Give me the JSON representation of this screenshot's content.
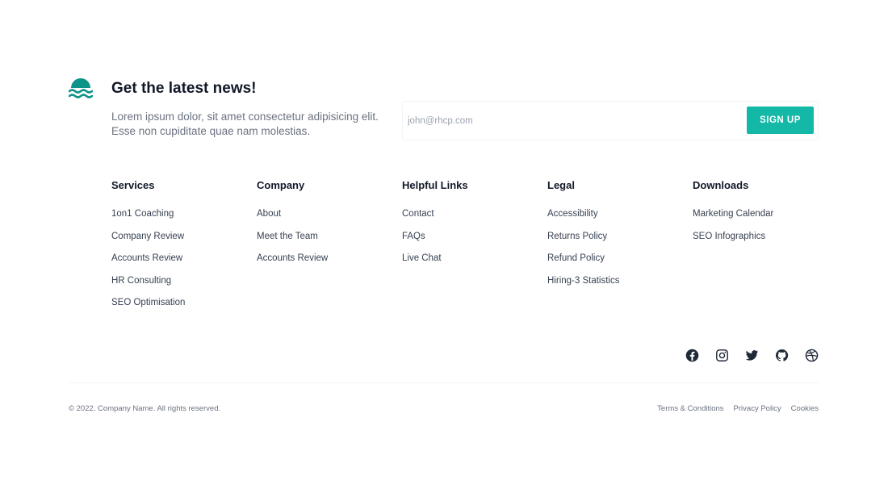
{
  "brand": {
    "logo_icon": "waves-icon",
    "accent": "#14b8a6"
  },
  "newsletter": {
    "title": "Get the latest news!",
    "description": "Lorem ipsum dolor, sit amet consectetur adipisicing elit. Esse non cupiditate quae nam molestias.",
    "email_placeholder": "john@rhcp.com",
    "email_value": "",
    "signup_label": "SIGN UP"
  },
  "columns": [
    {
      "title": "Services",
      "links": [
        "1on1 Coaching",
        "Company Review",
        "Accounts Review",
        "HR Consulting",
        "SEO Optimisation"
      ]
    },
    {
      "title": "Company",
      "links": [
        "About",
        "Meet the Team",
        "Accounts Review"
      ]
    },
    {
      "title": "Helpful Links",
      "links": [
        "Contact",
        "FAQs",
        "Live Chat"
      ]
    },
    {
      "title": "Legal",
      "links": [
        "Accessibility",
        "Returns Policy",
        "Refund Policy",
        "Hiring-3 Statistics"
      ]
    },
    {
      "title": "Downloads",
      "links": [
        "Marketing Calendar",
        "SEO Infographics"
      ]
    }
  ],
  "socials": [
    "facebook-icon",
    "instagram-icon",
    "twitter-icon",
    "github-icon",
    "dribbble-icon"
  ],
  "footer": {
    "copyright": "© 2022. Company Name. All rights reserved.",
    "legal_links": [
      "Terms & Conditions",
      "Privacy Policy",
      "Cookies"
    ]
  }
}
